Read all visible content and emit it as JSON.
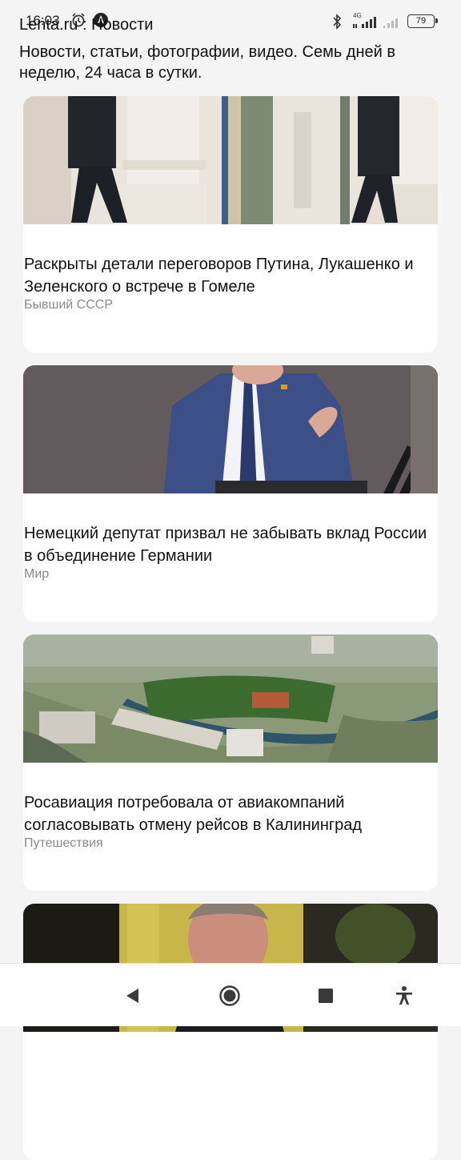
{
  "status_bar": {
    "time": "16:03",
    "network_label": "4G",
    "battery": "79",
    "icons": [
      "alarm-icon",
      "app-notification-icon",
      "bluetooth-icon",
      "signal-icon",
      "signal-icon",
      "battery-icon"
    ]
  },
  "header": {
    "title": "Lenta.ru : Новости",
    "subtitle": "Новости, статьи, фотографии, видео. Семь дней в неделю, 24 часа в сутки."
  },
  "articles": [
    {
      "title": "Раскрыты детали переговоров Путина, Лукашенко и Зеленского о встрече в Гомеле",
      "category": "Бывший СССР"
    },
    {
      "title": "Немецкий депутат призвал не забывать вклад России в объединение Германии",
      "category": "Мир"
    },
    {
      "title": "Росавиация потребовала от авиакомпаний согласовывать отмену рейсов в Калининград",
      "category": "Путешествия"
    },
    {
      "title": "",
      "category": ""
    }
  ],
  "nav_bar": {
    "icons": [
      "back-icon",
      "home-icon",
      "recents-icon",
      "accessibility-icon"
    ]
  },
  "colors": {
    "background": "#f4f4f4",
    "card": "#ffffff",
    "category_text": "#8a8a8a"
  }
}
